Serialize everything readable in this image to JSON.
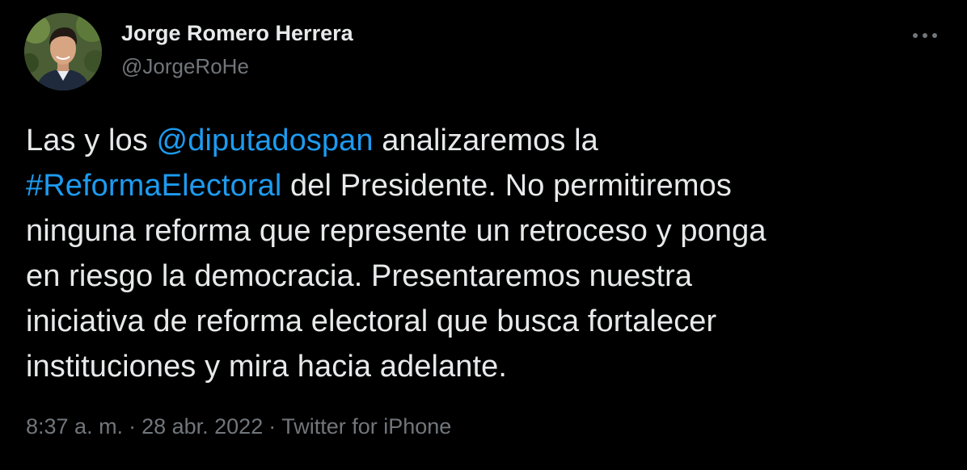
{
  "author": {
    "display_name": "Jorge Romero Herrera",
    "handle": "@JorgeRoHe"
  },
  "tweet": {
    "lines": [
      [
        {
          "text": "Las y los ",
          "type": "text"
        },
        {
          "text": "@diputadospan",
          "type": "mention"
        },
        {
          "text": " analizaremos la",
          "type": "text"
        }
      ],
      [
        {
          "text": "#ReformaElectoral",
          "type": "hashtag"
        },
        {
          "text": " del Presidente. No permitiremos",
          "type": "text"
        }
      ],
      [
        {
          "text": "ninguna reforma que represente un retroceso y ponga",
          "type": "text"
        }
      ],
      [
        {
          "text": "en riesgo la democracia. Presentaremos nuestra",
          "type": "text"
        }
      ],
      [
        {
          "text": "iniciativa de reforma electoral que busca fortalecer",
          "type": "text"
        }
      ],
      [
        {
          "text": "instituciones y mira hacia adelante.",
          "type": "text"
        }
      ]
    ]
  },
  "meta": {
    "time": "8:37 a. m.",
    "separator": "·",
    "date": "28 abr. 2022",
    "source": "Twitter for iPhone"
  },
  "icons": {
    "more": "more-horizontal-icon"
  },
  "colors": {
    "background": "#000000",
    "text": "#e7e9ea",
    "secondary": "#71767b",
    "link": "#1d9bf0"
  }
}
